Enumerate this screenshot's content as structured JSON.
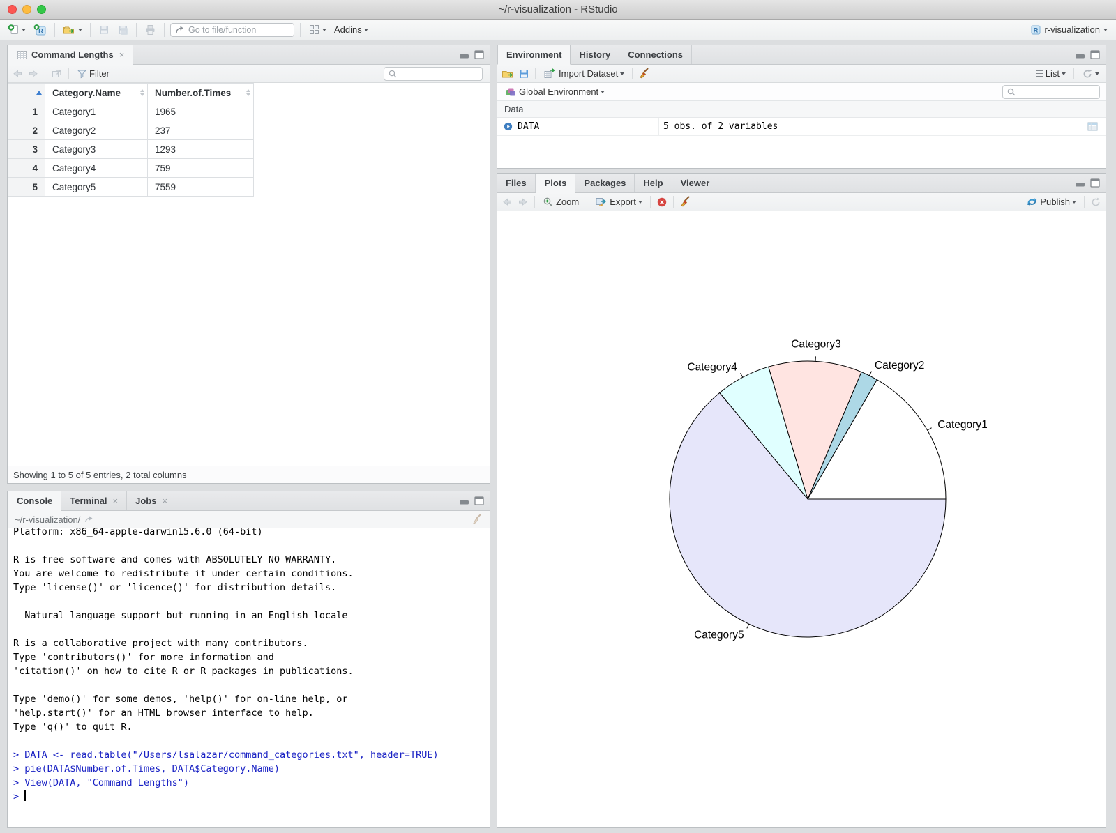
{
  "window": {
    "title": "~/r-visualization - RStudio",
    "project_label": "r-visualization"
  },
  "main_toolbar": {
    "goto_placeholder": "Go to file/function",
    "addins_label": "Addins"
  },
  "viewer": {
    "tab_label": "Command Lengths",
    "filter_label": "Filter",
    "table": {
      "columns": [
        "Category.Name",
        "Number.of.Times"
      ],
      "rows": [
        [
          "1",
          "Category1",
          "1965"
        ],
        [
          "2",
          "Category2",
          "237"
        ],
        [
          "3",
          "Category3",
          "1293"
        ],
        [
          "4",
          "Category4",
          "759"
        ],
        [
          "5",
          "Category5",
          "7559"
        ]
      ]
    },
    "status": "Showing 1 to 5 of 5 entries, 2 total columns"
  },
  "environment": {
    "tabs": [
      "Environment",
      "History",
      "Connections"
    ],
    "import_label": "Import Dataset",
    "list_label": "List",
    "scope_label": "Global Environment",
    "section_label": "Data",
    "objects": [
      {
        "name": "DATA",
        "desc": "5 obs. of 2 variables"
      }
    ]
  },
  "plots": {
    "tabs": [
      "Files",
      "Plots",
      "Packages",
      "Help",
      "Viewer"
    ],
    "zoom_label": "Zoom",
    "export_label": "Export",
    "publish_label": "Publish"
  },
  "console": {
    "tabs": [
      {
        "label": "Console",
        "closable": false
      },
      {
        "label": "Terminal",
        "closable": true
      },
      {
        "label": "Jobs",
        "closable": true
      }
    ],
    "path": "~/r-visualization/",
    "lines": [
      {
        "type": "out",
        "text": "Platform: x86_64-apple-darwin15.6.0 (64-bit)"
      },
      {
        "type": "out",
        "text": ""
      },
      {
        "type": "out",
        "text": "R is free software and comes with ABSOLUTELY NO WARRANTY."
      },
      {
        "type": "out",
        "text": "You are welcome to redistribute it under certain conditions."
      },
      {
        "type": "out",
        "text": "Type 'license()' or 'licence()' for distribution details."
      },
      {
        "type": "out",
        "text": ""
      },
      {
        "type": "out",
        "text": "  Natural language support but running in an English locale"
      },
      {
        "type": "out",
        "text": ""
      },
      {
        "type": "out",
        "text": "R is a collaborative project with many contributors."
      },
      {
        "type": "out",
        "text": "Type 'contributors()' for more information and"
      },
      {
        "type": "out",
        "text": "'citation()' on how to cite R or R packages in publications."
      },
      {
        "type": "out",
        "text": ""
      },
      {
        "type": "out",
        "text": "Type 'demo()' for some demos, 'help()' for on-line help, or"
      },
      {
        "type": "out",
        "text": "'help.start()' for an HTML browser interface to help."
      },
      {
        "type": "out",
        "text": "Type 'q()' to quit R."
      },
      {
        "type": "out",
        "text": ""
      },
      {
        "type": "in",
        "text": "> DATA <- read.table(\"/Users/lsalazar/command_categories.txt\", header=TRUE)"
      },
      {
        "type": "in",
        "text": "> pie(DATA$Number.of.Times, DATA$Category.Name)"
      },
      {
        "type": "in",
        "text": "> View(DATA, \"Command Lengths\")"
      }
    ],
    "prompt": "> "
  },
  "chart_data": {
    "type": "pie",
    "categories": [
      "Category1",
      "Category2",
      "Category3",
      "Category4",
      "Category5"
    ],
    "values": [
      1965,
      237,
      1293,
      759,
      7559
    ],
    "colors": [
      "#FFFFFF",
      "#ADD8E6",
      "#FFE4E1",
      "#E0FFFF",
      "#E6E6FA"
    ],
    "start_angle_deg": 0,
    "direction": "counterclockwise",
    "title": "",
    "legend": "none"
  }
}
